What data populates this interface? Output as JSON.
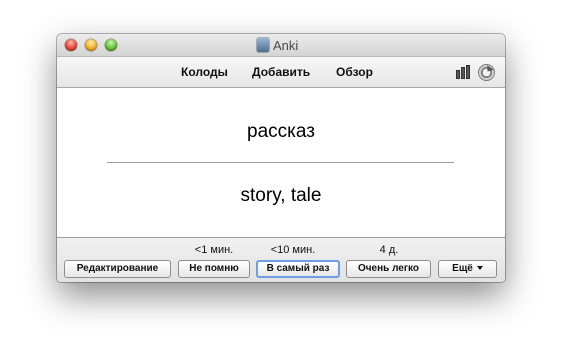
{
  "window": {
    "title": "Anki"
  },
  "toolbar": {
    "decks": "Колоды",
    "add": "Добавить",
    "browse": "Обзор"
  },
  "card": {
    "front": "рассказ",
    "back": "story, tale"
  },
  "intervals": {
    "again": "<1 мин.",
    "good": "<10 мин.",
    "easy": "4 д."
  },
  "buttons": {
    "edit": "Редактирование",
    "again": "Не помню",
    "good": "В самый раз",
    "easy": "Очень легко",
    "more": "Ещё"
  },
  "icons": {
    "stats": "bar-chart-icon",
    "sync": "sync-icon"
  }
}
